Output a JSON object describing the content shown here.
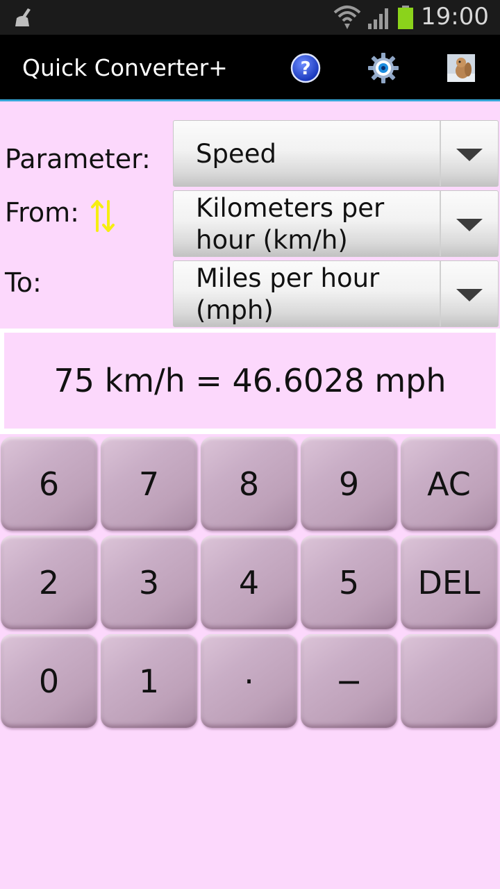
{
  "status_bar": {
    "time": "19:00"
  },
  "app": {
    "title": "Quick Converter+",
    "help_icon": "help-icon",
    "settings_icon": "gear-icon",
    "profile_icon": "profile-image-icon"
  },
  "form": {
    "parameter_label": "Parameter:",
    "parameter_value": "Speed",
    "from_label": "From:",
    "from_value": "Kilometers per hour (km/h)",
    "to_label": "To:",
    "to_value": "Miles per hour (mph)"
  },
  "result": {
    "text": "75 km/h = 46.6028 mph"
  },
  "keypad": {
    "rows": [
      [
        "6",
        "7",
        "8",
        "9",
        "AC"
      ],
      [
        "2",
        "3",
        "4",
        "5",
        "DEL"
      ],
      [
        "0",
        "1",
        "·",
        "−",
        ""
      ]
    ]
  },
  "colors": {
    "background": "#fcd8fc",
    "action_bar": "#000000",
    "accent_line": "#35a6d6",
    "key": "#c2a6be",
    "swap_icon": "#f6ee12"
  }
}
